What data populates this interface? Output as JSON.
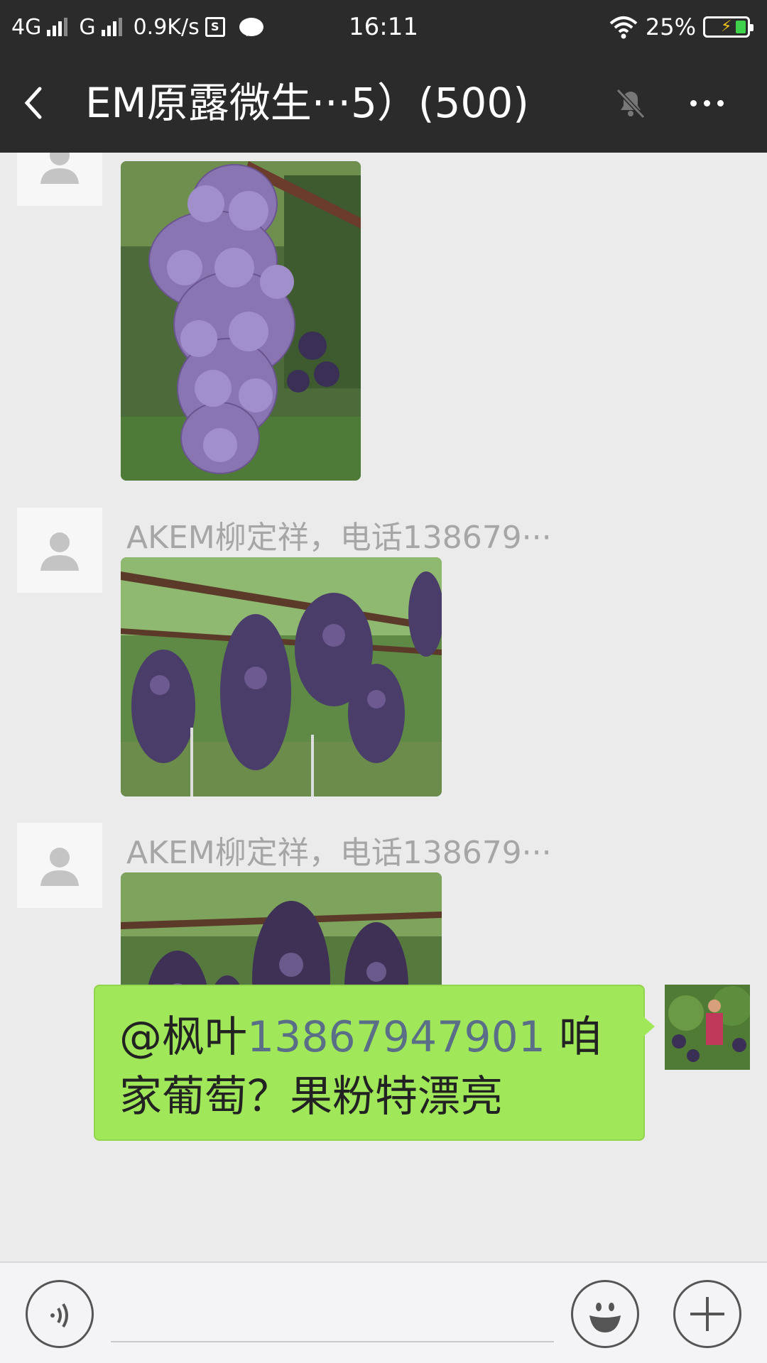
{
  "status_bar": {
    "network_4g": "4G",
    "network_g": "G",
    "speed": "0.9K/s",
    "sim_label": "S",
    "time": "16:11",
    "battery": "25%",
    "battery_level": 0.25
  },
  "header": {
    "title": "EM原露微生···5）(500)",
    "muted": true
  },
  "messages": [
    {
      "sender": "",
      "type": "image",
      "subject": "purple grape bunch close-up"
    },
    {
      "sender": "AKEM柳定祥，电话138679···",
      "type": "image",
      "subject": "grapes hanging on vine"
    },
    {
      "sender": "AKEM柳定祥，电话138679···",
      "type": "image",
      "subject": "grapes in vineyard"
    },
    {
      "sender": "self",
      "type": "text",
      "mention": "@枫叶",
      "phone": "13867947901",
      "text_line1_end": " 咱",
      "text_line2": "家葡萄？果粉特漂亮"
    }
  ],
  "input": {
    "placeholder": ""
  },
  "colors": {
    "header_bg": "#2b2b2b",
    "chat_bg": "#ebebeb",
    "bubble_green": "#a0e759",
    "link_gray": "#5a6f87"
  },
  "icons": [
    "back-arrow-icon",
    "mute-bell-icon",
    "more-dots-icon",
    "voice-icon",
    "emoji-icon",
    "plus-icon",
    "default-avatar-icon"
  ]
}
